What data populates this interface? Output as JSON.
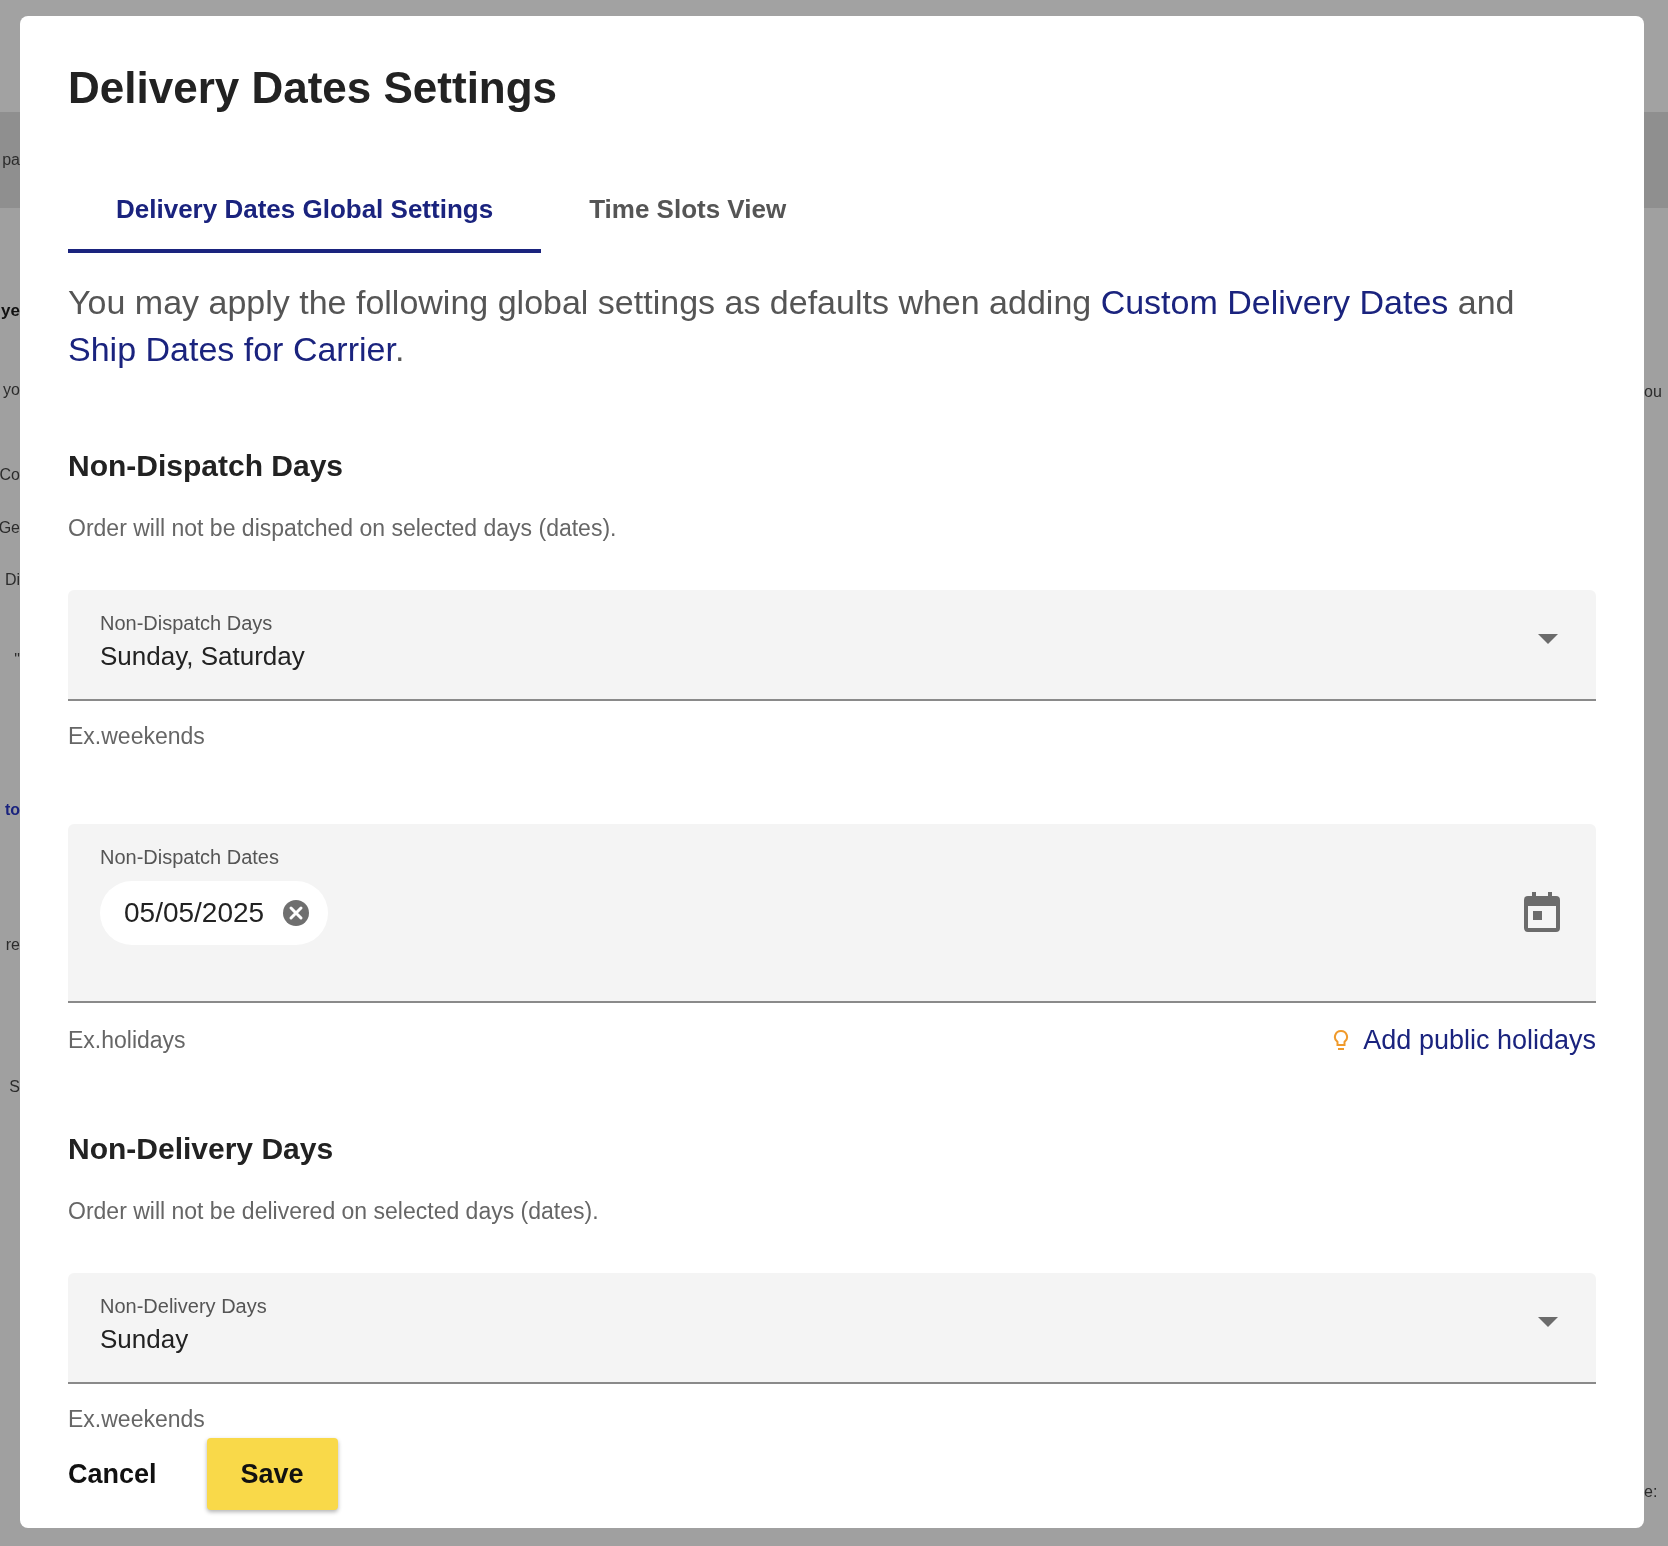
{
  "background": {
    "left_fragments": [
      {
        "kind": "text",
        "text": "pa"
      },
      {
        "kind": "heading",
        "text": "ye"
      },
      {
        "kind": "text",
        "text": "yo"
      },
      {
        "kind": "text",
        "text": "Co"
      },
      {
        "kind": "text",
        "text": "Ge"
      },
      {
        "kind": "text",
        "text": "Di"
      },
      {
        "kind": "text",
        "text": "\""
      },
      {
        "kind": "tab",
        "text": "to"
      },
      {
        "kind": "text",
        "text": "re"
      },
      {
        "kind": "text",
        "text": "S"
      }
    ],
    "right_fragments": [
      "ou",
      "e:"
    ]
  },
  "dialog": {
    "title": "Delivery Dates Settings",
    "tabs": [
      {
        "label": "Delivery Dates Global Settings",
        "selected": true
      },
      {
        "label": "Time Slots View",
        "selected": false
      }
    ],
    "intro": [
      {
        "kind": "text",
        "text": "You may apply the following global settings as defaults when adding "
      },
      {
        "kind": "link",
        "text": "Custom Delivery Dates"
      },
      {
        "kind": "text",
        "text": " and "
      },
      {
        "kind": "link",
        "text": "Ship Dates for Carrier"
      },
      {
        "kind": "text",
        "text": "."
      }
    ],
    "sections": [
      {
        "heading": "Non-Dispatch Days",
        "description": "Order will not be dispatched on selected days (dates).",
        "fields": [
          {
            "kind": "select",
            "label": "Non-Dispatch Days",
            "value": "Sunday, Saturday",
            "helper": "Ex.weekends"
          },
          {
            "kind": "dates",
            "label": "Non-Dispatch Dates",
            "chips": [
              "05/05/2025"
            ],
            "helper": "Ex.holidays",
            "link": "Add public holidays"
          }
        ]
      },
      {
        "heading": "Non-Delivery Days",
        "description": "Order will not be delivered on selected days (dates).",
        "fields": [
          {
            "kind": "select",
            "label": "Non-Delivery Days",
            "value": "Sunday",
            "helper": "Ex.weekends"
          }
        ]
      }
    ],
    "buttons": [
      {
        "kind": "text",
        "label": "Cancel"
      },
      {
        "kind": "primary",
        "label": "Save"
      }
    ]
  }
}
